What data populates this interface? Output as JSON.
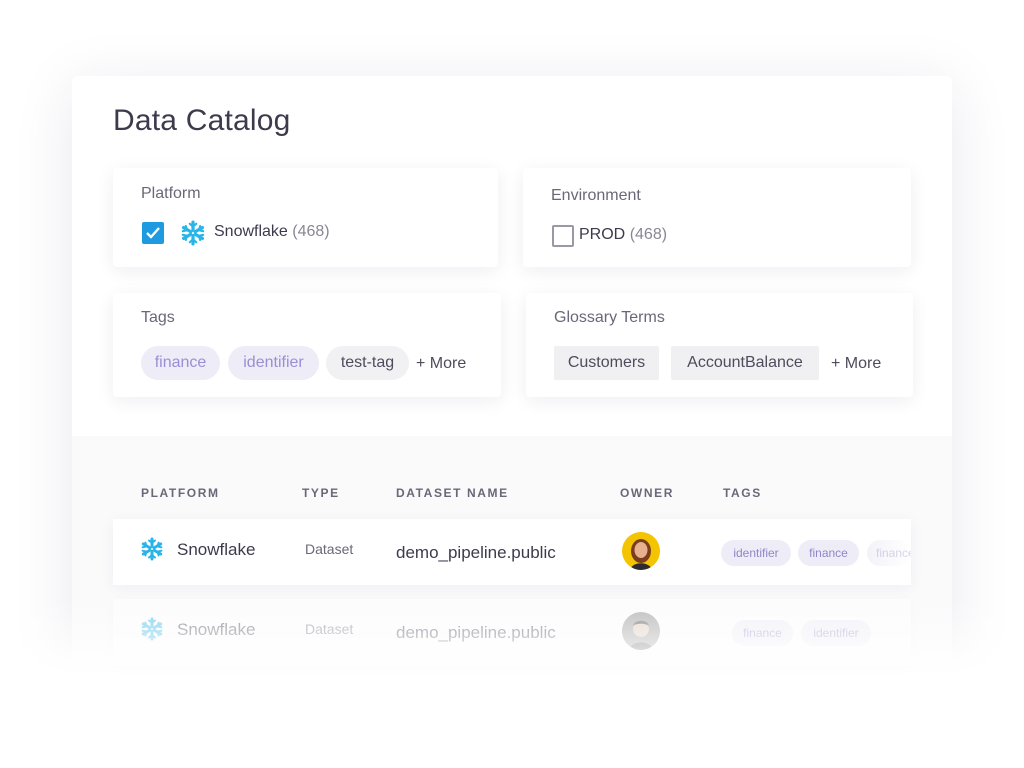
{
  "page": {
    "title": "Data Catalog"
  },
  "filters": {
    "platform": {
      "label": "Platform",
      "option": {
        "icon": "snowflake-icon",
        "name": "Snowflake",
        "count": "(468)",
        "checked": true
      }
    },
    "environment": {
      "label": "Environment",
      "option": {
        "name": "PROD",
        "count": "(468)",
        "checked": false
      }
    },
    "tags": {
      "label": "Tags",
      "items": [
        "finance",
        "identifier",
        "test-tag"
      ],
      "more": "+ More"
    },
    "glossary": {
      "label": "Glossary Terms",
      "items": [
        "Customers",
        "AccountBalance"
      ],
      "more": "+ More"
    }
  },
  "table": {
    "headers": [
      "PLATFORM",
      "TYPE",
      "DATASET NAME",
      "OWNER",
      "TAGS"
    ],
    "rows": [
      {
        "platform": "Snowflake",
        "type": "Dataset",
        "name": "demo_pipeline.public",
        "owner": "avatar-woman",
        "tags": [
          "identifier",
          "finance",
          "finance"
        ]
      },
      {
        "platform": "Snowflake",
        "type": "Dataset",
        "name": "demo_pipeline.public",
        "owner": "avatar-man",
        "tags": [
          "finance",
          "identifier"
        ]
      }
    ]
  },
  "colors": {
    "accent": "#1e9ae0",
    "snowflake": "#29b5e8",
    "tag_purple_bg": "#eeecf7",
    "tag_purple_text": "#9a8fd4"
  }
}
